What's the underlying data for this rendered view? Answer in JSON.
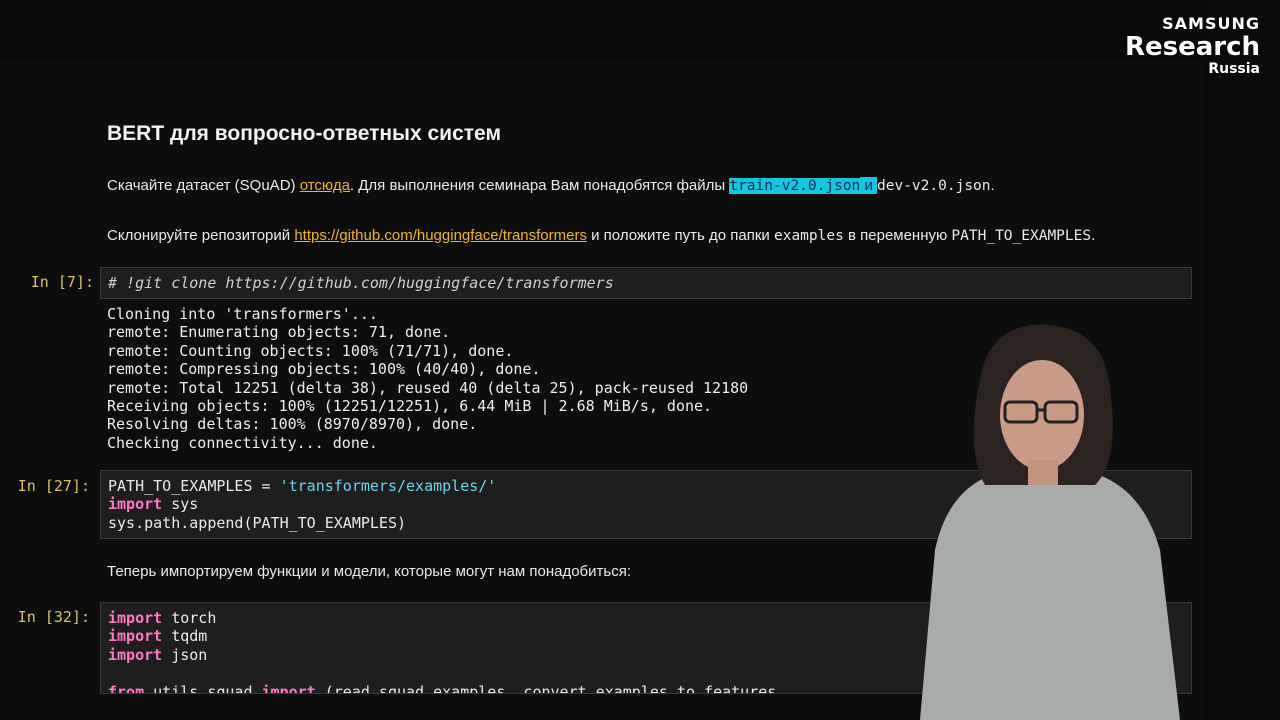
{
  "logo": {
    "line1": "SAMSUNG",
    "line2": "Research",
    "line3": "Russia"
  },
  "notebook": {
    "title": "BERT для вопросно-ответных систем",
    "para1": {
      "before": "Скачайте датасет (SQuAD) ",
      "link": "отсюда",
      "middle": ". Для выполнения семинара Вам понадобятся файлы ",
      "file1": "train-v2.0.json",
      "and": " и ",
      "file2": "dev-v2.0.json",
      "end": "."
    },
    "para2": {
      "before": "Склонируйте репозиторий ",
      "link": "https://github.com/huggingface/transformers",
      "middle": " и положите путь до папки ",
      "folder": "examples",
      "middle2": " в переменную ",
      "var": "PATH_TO_EXAMPLES",
      "end": "."
    },
    "cells": [
      {
        "prompt": "In [7]:",
        "comment": "# !git clone https://github.com/huggingface/transformers"
      },
      {
        "prompt": "In [27]:",
        "line1_var": "PATH_TO_EXAMPLES = ",
        "line1_str": "'transformers/examples/'",
        "line2_kw": "import",
        "line2_rest": " sys",
        "line3": "sys.path.append(PATH_TO_EXAMPLES)"
      },
      {
        "prompt": "In [32]:",
        "l1_kw": "import",
        "l1_rest": " torch",
        "l2_kw": "import",
        "l2_rest": " tqdm",
        "l3_kw": "import",
        "l3_rest": " json",
        "l5_kw1": "from",
        "l5_mid": " utils_squad ",
        "l5_kw2": "import",
        "l5_rest": " (read_squad_examples, convert_examples_to_features,"
      }
    ],
    "output_lines": "Cloning into 'transformers'...\nremote: Enumerating objects: 71, done.\nremote: Counting objects: 100% (71/71), done.\nremote: Compressing objects: 100% (40/40), done.\nremote: Total 12251 (delta 38), reused 40 (delta 25), pack-reused 12180\nReceiving objects: 100% (12251/12251), 6.44 MiB | 2.68 MiB/s, done.\nResolving deltas: 100% (8970/8970), done.\nChecking connectivity... done.",
    "para3": "Теперь импортируем функции и модели, которые могут нам понадобиться:"
  }
}
